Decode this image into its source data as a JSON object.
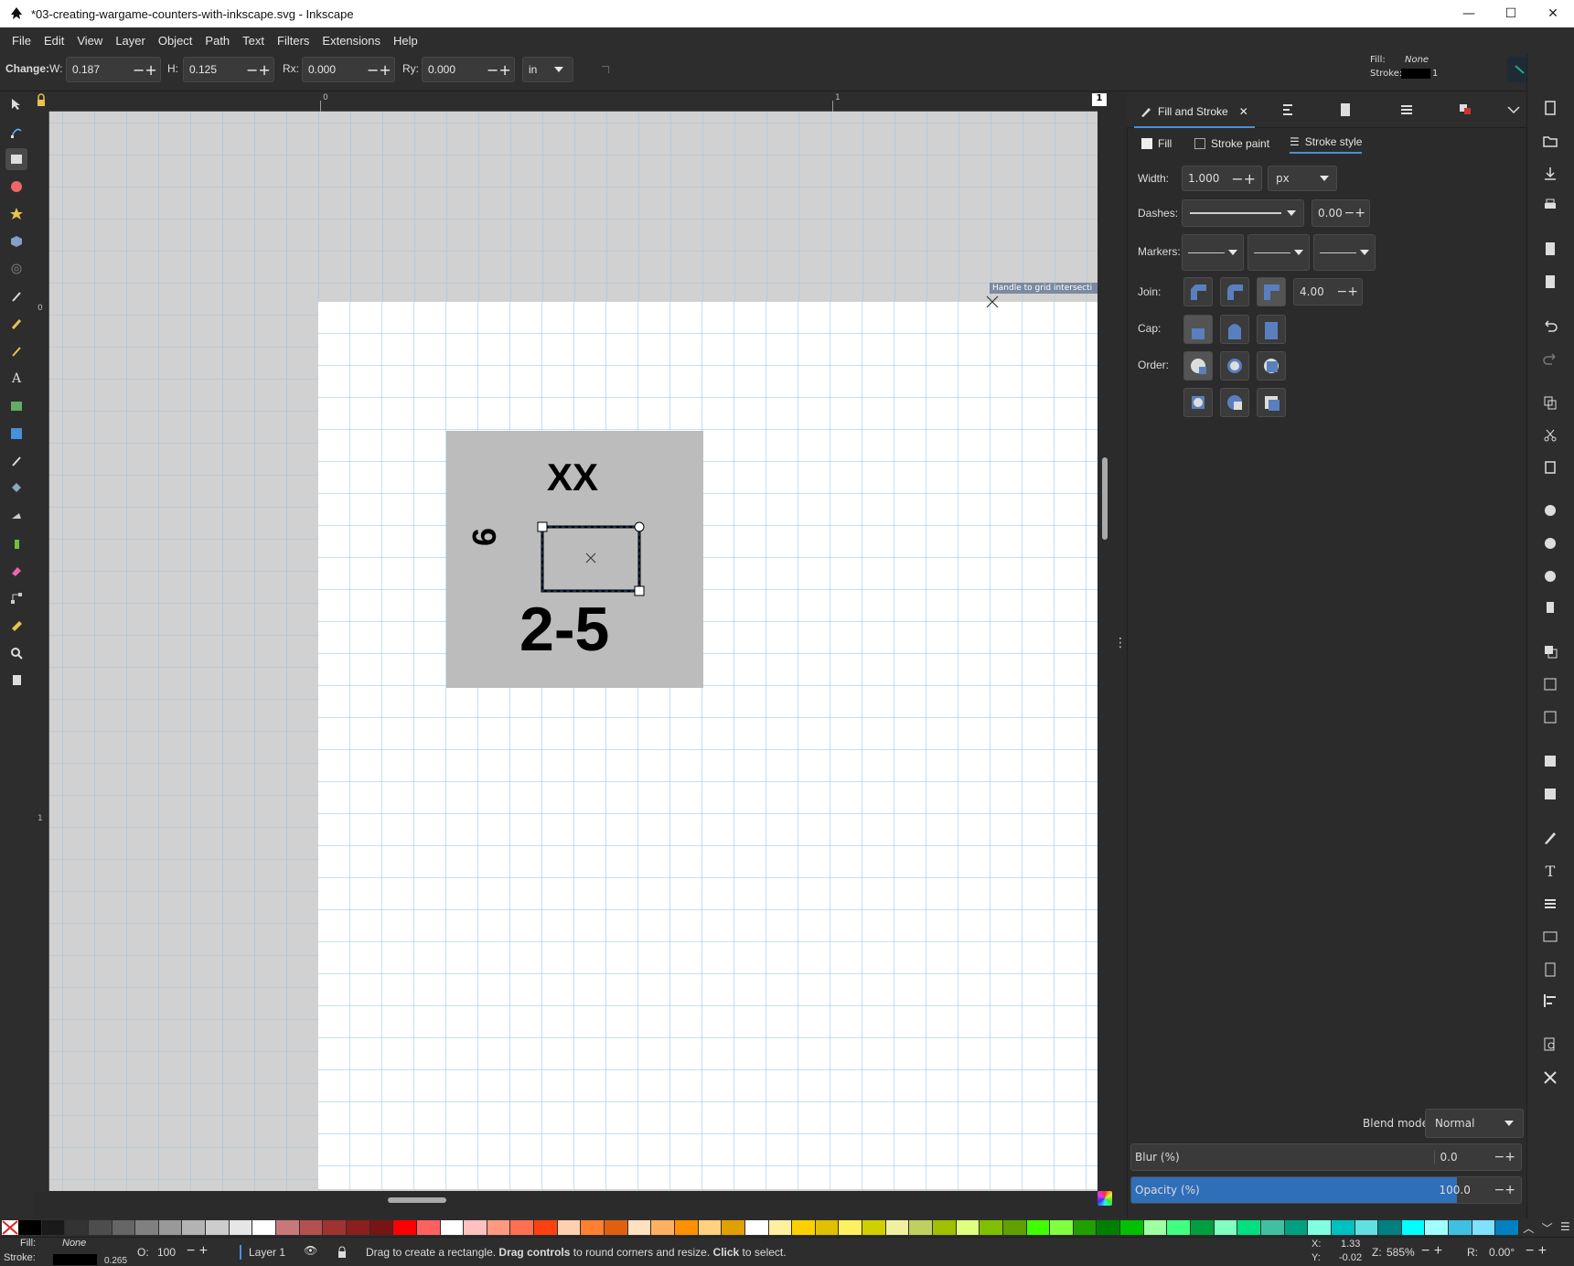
{
  "window": {
    "title": "*03-creating-wargame-counters-with-inkscape.svg - Inkscape",
    "minimize": "—",
    "maximize": "☐",
    "close": "✕"
  },
  "menu": [
    "File",
    "Edit",
    "View",
    "Layer",
    "Object",
    "Path",
    "Text",
    "Filters",
    "Extensions",
    "Help"
  ],
  "toolcontrols": {
    "change_label": "Change:",
    "w_label": "W:",
    "w_value": "0.187",
    "h_label": "H:",
    "h_value": "0.125",
    "rx_label": "Rx:",
    "rx_value": "0.000",
    "ry_label": "Ry:",
    "ry_value": "0.000",
    "unit": "in",
    "fill_label": "Fill:",
    "fill_value": "None",
    "stroke_label": "Stroke:",
    "stroke_width": "1"
  },
  "ruler": {
    "top_labels": [
      "0",
      "1"
    ],
    "left_labels": [
      "0",
      "1"
    ],
    "page_number": "1"
  },
  "canvas": {
    "snap_tooltip": "Handle to grid intersecti",
    "counter": {
      "top_text": "XX",
      "side_text": "6",
      "bottom_text": "2-5"
    }
  },
  "dock": {
    "tab_title": "Fill and Stroke",
    "subtabs": {
      "fill": "Fill",
      "stroke_paint": "Stroke paint",
      "stroke_style": "Stroke style"
    },
    "width_label": "Width:",
    "width_value": "1.000",
    "width_unit": "px",
    "dashes_label": "Dashes:",
    "dashes_value": "0.00",
    "markers_label": "Markers:",
    "join_label": "Join:",
    "miter_value": "4.00",
    "cap_label": "Cap:",
    "order_label": "Order:",
    "blend_label": "Blend mode:",
    "blend_value": "Normal",
    "blur_label": "Blur (%)",
    "blur_value": "0.0",
    "opacity_label": "Opacity (%)",
    "opacity_value": "100.0",
    "opacity_fraction": 1.0
  },
  "statusbar": {
    "fill_label": "Fill:",
    "fill_value": "None",
    "stroke_label": "Stroke:",
    "stroke_width": "0.265",
    "opacity_label": "O:",
    "opacity_value": "100",
    "layer": "Layer 1",
    "message_pre": "Drag to create a rectangle. ",
    "message_b1": "Drag controls",
    "message_mid": " to round corners and resize. ",
    "message_b2": "Click",
    "message_post": " to select.",
    "x_label": "X:",
    "x_value": "1.33",
    "y_label": "Y:",
    "y_value": "-0.02",
    "zoom_label": "Z:",
    "zoom_value": "585%",
    "rot_label": "R:",
    "rot_value": "0.00°"
  },
  "palette_colors": [
    "#000000",
    "#1a1a1a",
    "#333333",
    "#4d4d4d",
    "#666666",
    "#808080",
    "#999999",
    "#b3b3b3",
    "#cccccc",
    "#e6e6e6",
    "#ffffff",
    "#c87878",
    "#b45050",
    "#a03232",
    "#8c1e1e",
    "#781414",
    "#ff0000",
    "#ff6060",
    "#ffffff",
    "#ffc0c0",
    "#ff9a80",
    "#ff7050",
    "#ff4010",
    "#ffd0b0",
    "#ff8030",
    "#e06010",
    "#ffe0c0",
    "#ffb060",
    "#ff9000",
    "#ffd080",
    "#e0a000",
    "#ffffff",
    "#fff0a0",
    "#ffd000",
    "#e0c000",
    "#fff060",
    "#d0d000",
    "#f0f0a0",
    "#c0d060",
    "#a0c000",
    "#e0ff80",
    "#80c000",
    "#60a000",
    "#40ff00",
    "#80ff40",
    "#20a000",
    "#008000",
    "#00c000",
    "#a0ffa0",
    "#40ff80",
    "#00a040",
    "#80ffc0",
    "#00e080",
    "#40c0a0",
    "#00a080",
    "#80ffe0",
    "#00c0c0",
    "#60e0e0",
    "#008080",
    "#00ffff",
    "#a0ffff",
    "#40c0e0",
    "#80e0ff",
    "#0080c0"
  ]
}
